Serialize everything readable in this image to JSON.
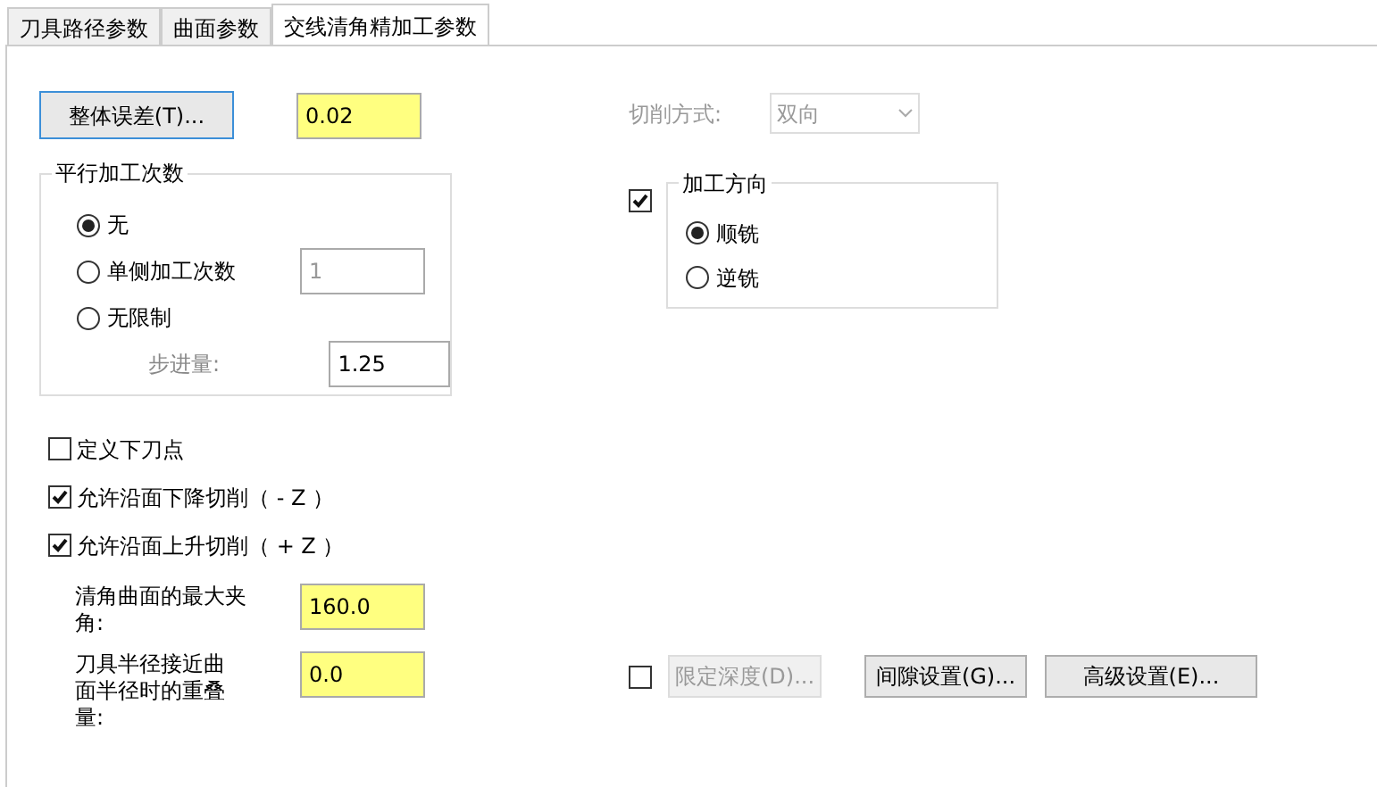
{
  "tabs": [
    {
      "label": "刀具路径参数",
      "selected": false
    },
    {
      "label": "曲面参数",
      "selected": false
    },
    {
      "label": "交线清角精加工参数",
      "selected": true
    }
  ],
  "tolerance": {
    "button": "整体误差(T)...",
    "value": "0.02"
  },
  "parallel_passes": {
    "title": "平行加工次数",
    "options": [
      {
        "label": "无",
        "selected": true
      },
      {
        "label": "单侧加工次数",
        "selected": false,
        "value": "1",
        "value_disabled": true
      },
      {
        "label": "无限制",
        "selected": false
      }
    ],
    "stepover": {
      "label": "步进量:",
      "value": "1.25",
      "disabled": true
    }
  },
  "checkboxes": [
    {
      "label": "定义下刀点",
      "checked": false
    },
    {
      "label": "允许沿面下降切削（ - Z ）",
      "checked": true
    },
    {
      "label": "允许沿面上升切削（ + Z ）",
      "checked": true
    }
  ],
  "fields": [
    {
      "label": "清角曲面的最大夹角:",
      "value": "160.0"
    },
    {
      "label": "刀具半径接近曲面半径时的重叠量:",
      "value": "0.0"
    }
  ],
  "cut_method": {
    "label": "切削方式:",
    "value": "双向",
    "disabled": true
  },
  "direction": {
    "enabled": true,
    "title": "加工方向",
    "options": [
      {
        "label": "顺铣",
        "selected": true
      },
      {
        "label": "逆铣",
        "selected": false
      }
    ]
  },
  "limit_depth": {
    "checked": false,
    "label": "限定深度(D)...",
    "disabled": true
  },
  "buttons": [
    {
      "label": "间隙设置(G)..."
    },
    {
      "label": "高级设置(E)..."
    }
  ]
}
